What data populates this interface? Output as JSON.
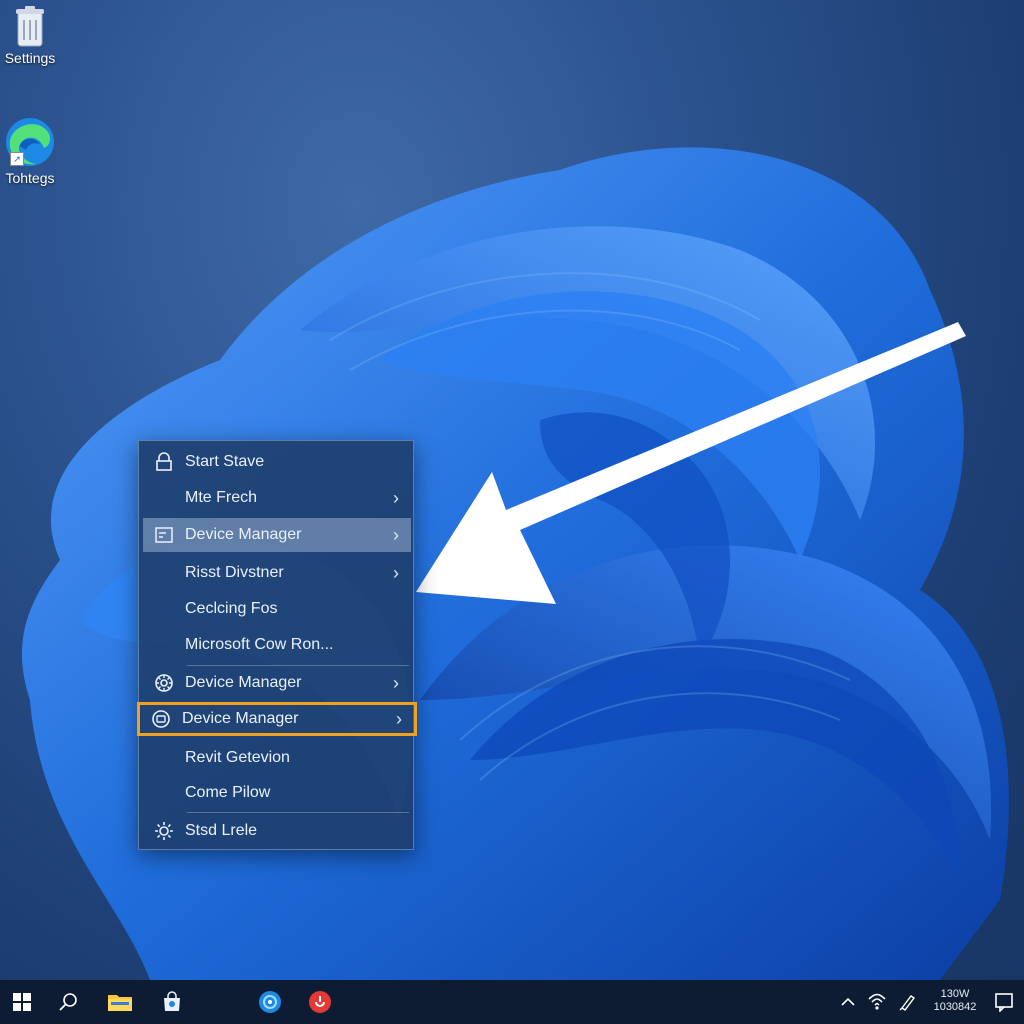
{
  "desktop": {
    "icons": [
      {
        "label": "Settings",
        "icon": "recycle-bin-icon"
      },
      {
        "label": "Tohtegs",
        "icon": "edge-browser-icon"
      }
    ]
  },
  "context_menu": {
    "items": [
      {
        "label": "Start Stave",
        "icon": "lock-icon",
        "has_submenu": false
      },
      {
        "label": "Mte Frech",
        "icon": "",
        "has_submenu": true
      },
      {
        "label": "Device Manager",
        "icon": "list-icon",
        "has_submenu": true,
        "state": "hover"
      },
      {
        "label": "Risst Divstner",
        "icon": "",
        "has_submenu": true
      },
      {
        "label": "Ceclcing Fos",
        "icon": "",
        "has_submenu": false
      },
      {
        "label": "Microsoft Cow Ron...",
        "icon": "",
        "has_submenu": false
      },
      {
        "label": "Device Manager",
        "icon": "gear-icon",
        "has_submenu": true
      },
      {
        "label": "Device Manager",
        "icon": "device-icon",
        "has_submenu": true,
        "state": "selected"
      },
      {
        "label": "Revit Getevion",
        "icon": "",
        "has_submenu": false
      },
      {
        "label": "Come Pilow",
        "icon": "",
        "has_submenu": false
      },
      {
        "label": "Stsd Lrele",
        "icon": "sun-icon",
        "has_submenu": false
      }
    ],
    "chevron": "›",
    "highlight_color": "#f0a21f"
  },
  "taskbar": {
    "apps": [
      "windows-start-icon",
      "search-icon",
      "file-explorer-icon",
      "store-icon",
      "edge-icon",
      "app-red-icon"
    ],
    "tray": {
      "icons": [
        "chevron-up-icon",
        "network-icon",
        "pen-icon"
      ],
      "time": "130W",
      "date": "1030842",
      "notification_icon": "notification-icon"
    }
  },
  "colors": {
    "desktop_bg": "#2c538f",
    "wallpaper_accent": "#1f6fe0",
    "taskbar": "#0e1c33"
  }
}
